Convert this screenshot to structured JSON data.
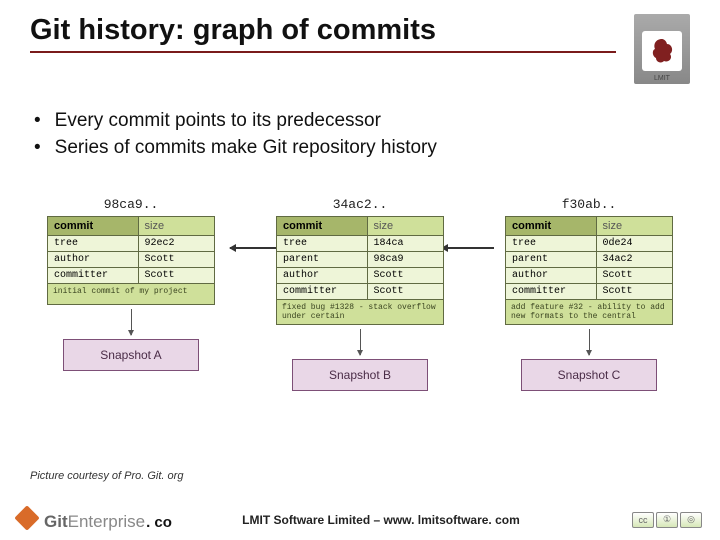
{
  "logo_text": "LMIT",
  "title": "Git history: graph of commits",
  "bullets": [
    "Every commit points to its predecessor",
    "Series of commits make Git repository history"
  ],
  "commit_header": {
    "left": "commit",
    "right": "size"
  },
  "commits": [
    {
      "hash": "98ca9..",
      "rows": [
        {
          "k": "tree",
          "v": "92ec2"
        },
        {
          "k": "author",
          "v": "Scott"
        },
        {
          "k": "committer",
          "v": "Scott"
        }
      ],
      "msg": "initial commit of my project",
      "snapshot": "Snapshot A"
    },
    {
      "hash": "34ac2..",
      "rows": [
        {
          "k": "tree",
          "v": "184ca"
        },
        {
          "k": "parent",
          "v": "98ca9"
        },
        {
          "k": "author",
          "v": "Scott"
        },
        {
          "k": "committer",
          "v": "Scott"
        }
      ],
      "msg": "fixed bug #1328 - stack overflow under certain",
      "snapshot": "Snapshot B"
    },
    {
      "hash": "f30ab..",
      "rows": [
        {
          "k": "tree",
          "v": "0de24"
        },
        {
          "k": "parent",
          "v": "34ac2"
        },
        {
          "k": "author",
          "v": "Scott"
        },
        {
          "k": "committer",
          "v": "Scott"
        }
      ],
      "msg": "add feature #32 - ability to add new formats to the central",
      "snapshot": "Snapshot C"
    }
  ],
  "credit": "Picture courtesy of  Pro. Git. org",
  "footer_brand": {
    "git": "Git",
    "enterprise": "Enterprise",
    "suffix": ". co"
  },
  "footer_copy": "LMIT Software Limited – www. lmitsoftware. com",
  "cc": [
    "cc",
    "①",
    "◎"
  ]
}
